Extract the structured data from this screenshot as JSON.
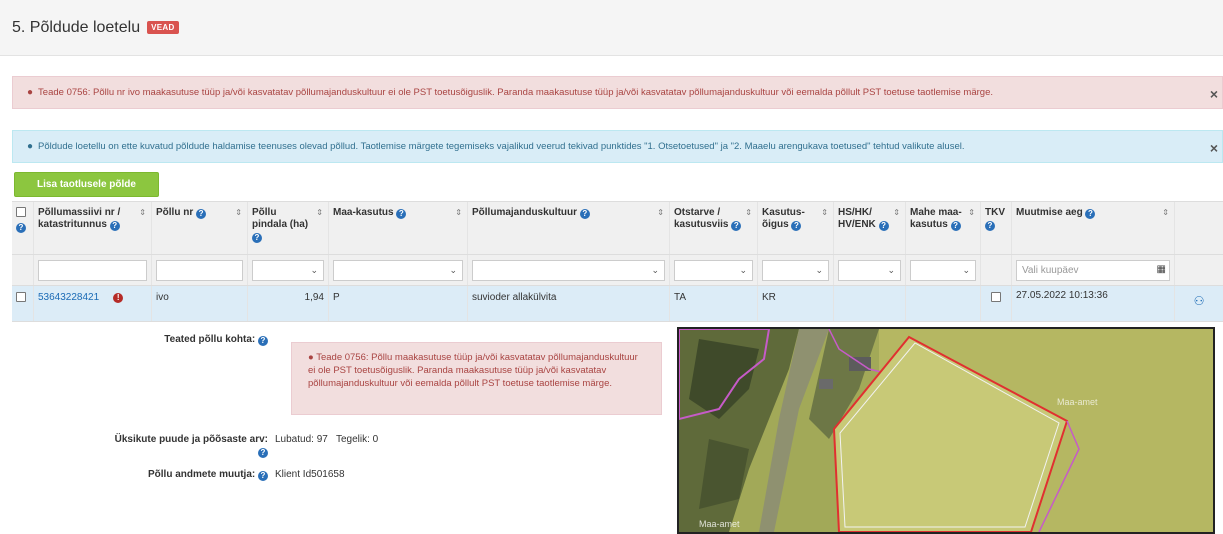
{
  "header": {
    "title": "5. Põldude loetelu",
    "badge": "VEAD"
  },
  "alerts": {
    "error": "Teade 0756: Põllu nr ivo maakasutuse tüüp ja/või kasvatatav põllumajanduskultuur ei ole PST toetusõiguslik. Paranda maakasutuse tüüp ja/või kasvatatav põllumajanduskultuur või eemalda põllult PST toetuse taotlemise märge.",
    "info": "Põldude loetellu on ette kuvatud põldude haldamise teenuses olevad põllud. Taotlemise märgete tegemiseks vajalikud veerud tekivad punktides \"1. Otsetoetused\" ja \"2. Maaelu arengukava toetused\" tehtud valikute alusel.",
    "close": "×"
  },
  "toolbar": {
    "add_button": "Lisa taotlusele põlde"
  },
  "table": {
    "columns": [
      "Põllumassiivi nr / katastritunnus",
      "Põllu nr",
      "Põllu pindala (ha)",
      "Maa-kasutus",
      "Põllumajanduskultuur",
      "Otstarve / kasutusviis",
      "Kasutus-õigus",
      "HS/HK/ HV/ENK",
      "Mahe maa-kasutus",
      "TKV",
      "Muutmise aeg"
    ],
    "date_placeholder": "Vali kuupäev",
    "row": {
      "massiiv": "53643228421",
      "pollu_nr": "ivo",
      "pindala": "1,94",
      "maakasutus": "P",
      "kultuur": "suvioder allakülvita",
      "otstarve": "TA",
      "kasutusoigus": "KR",
      "hs": "",
      "mahe": "",
      "muutmise_aeg": "27.05.2022 10:13:36"
    }
  },
  "detail": {
    "teated_label": "Teated põllu kohta:",
    "teated_message": "Teade 0756: Põllu maakasutuse tüüp ja/või kasvatatav põllumajanduskultuur ei ole PST toetusõiguslik. Paranda maakasutuse tüüp ja/või kasvatatav põllumajanduskultuur või eemalda põllult PST toetuse taotlemise märge.",
    "puude_label": "Üksikute puude ja põõsaste arv:",
    "puude_value": "Lubatud: 97   Tegelik: 0",
    "muutja_label": "Põllu andmete muutja:",
    "muutja_value": "Klient Id501658"
  },
  "map": {
    "label": "Maa-amet"
  },
  "colors": {
    "accent_green": "#8cc63f",
    "error": "#a94442",
    "info": "#31708f",
    "link": "#1a6ab5"
  }
}
